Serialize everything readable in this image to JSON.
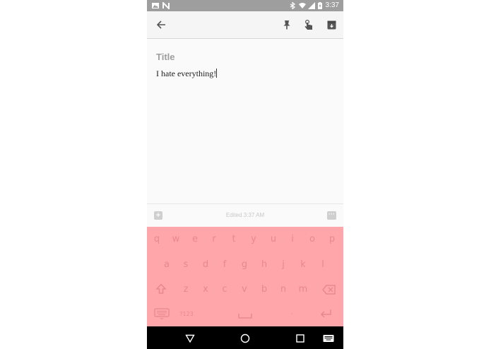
{
  "status_bar": {
    "time": "3:37",
    "icons": [
      "image-icon",
      "n-icon",
      "bluetooth-icon",
      "wifi-icon",
      "signal-icon",
      "battery-icon"
    ]
  },
  "toolbar": {
    "icons": [
      "back-arrow-icon",
      "pin-icon",
      "touch-icon",
      "archive-icon"
    ]
  },
  "note": {
    "title_placeholder": "Title",
    "body": "I hate everything!"
  },
  "bottom_bar": {
    "add_label": "+",
    "edited": "Edited 3:37 AM",
    "more_label": "···"
  },
  "keyboard": {
    "row1": [
      "q",
      "w",
      "e",
      "r",
      "t",
      "y",
      "u",
      "i",
      "o",
      "p"
    ],
    "row2": [
      "a",
      "s",
      "d",
      "f",
      "g",
      "h",
      "j",
      "k",
      "l"
    ],
    "row3": [
      "z",
      "x",
      "c",
      "v",
      "b",
      "n",
      "m"
    ],
    "symbols_key": "?123",
    "colors": {
      "background": "#ffa6ab",
      "key_text": "#e8888e"
    }
  },
  "navigation": {
    "icons": [
      "back-triangle-icon",
      "home-circle-icon",
      "recents-square-icon",
      "keyboard-switch-icon"
    ]
  },
  "colors": {
    "status_bar": "#9e9e9e",
    "toolbar": "#f5f5f5",
    "note_background": "#fafafa",
    "nav_bar": "#000000"
  }
}
